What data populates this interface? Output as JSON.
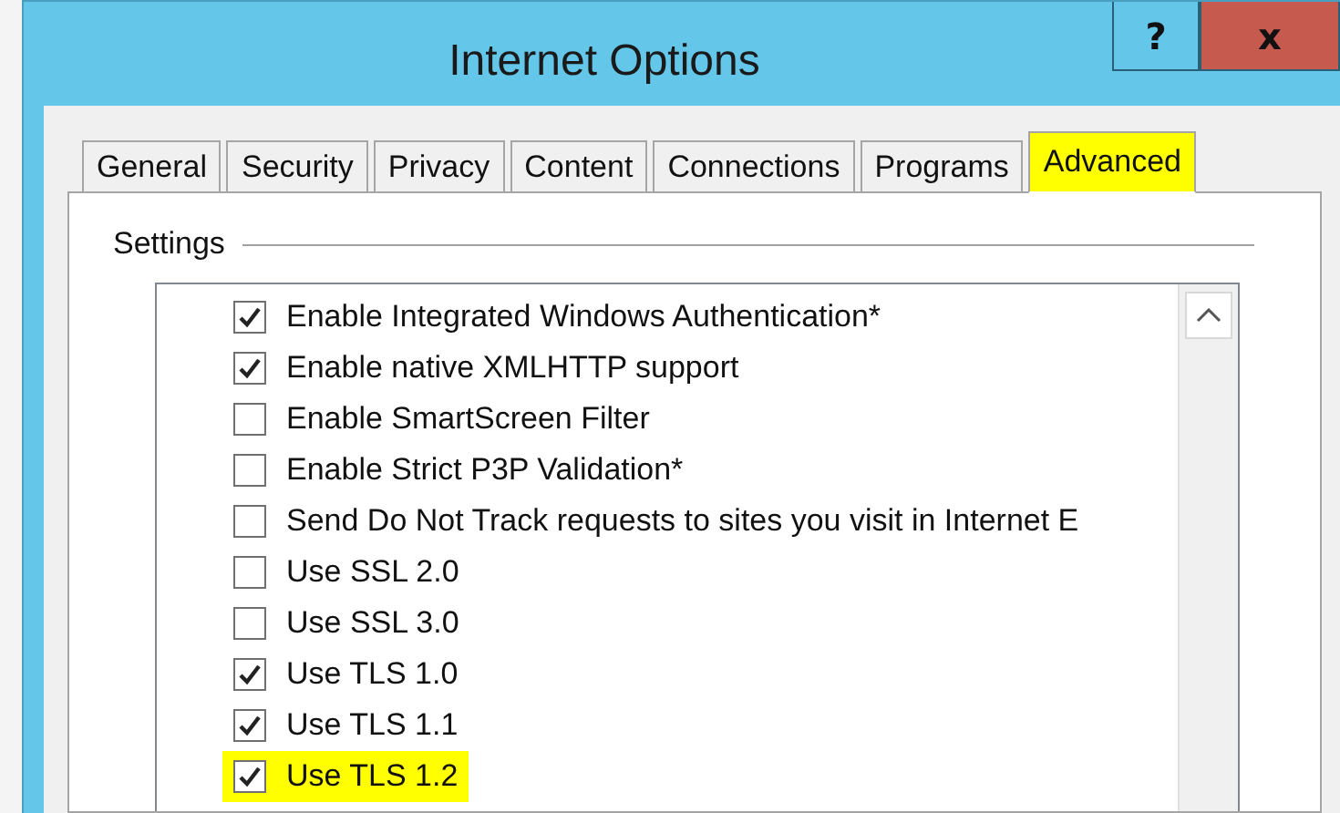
{
  "window": {
    "title": "Internet Options",
    "help_button": "?",
    "close_button": "x"
  },
  "tabs": [
    {
      "label": "General",
      "selected": false,
      "highlighted": false
    },
    {
      "label": "Security",
      "selected": false,
      "highlighted": false
    },
    {
      "label": "Privacy",
      "selected": false,
      "highlighted": false
    },
    {
      "label": "Content",
      "selected": false,
      "highlighted": false
    },
    {
      "label": "Connections",
      "selected": false,
      "highlighted": false
    },
    {
      "label": "Programs",
      "selected": false,
      "highlighted": false
    },
    {
      "label": "Advanced",
      "selected": true,
      "highlighted": true
    }
  ],
  "settings": {
    "title": "Settings",
    "items": [
      {
        "label": "Enable Integrated Windows Authentication*",
        "checked": true,
        "highlighted": false
      },
      {
        "label": "Enable native XMLHTTP support",
        "checked": true,
        "highlighted": false
      },
      {
        "label": "Enable SmartScreen Filter",
        "checked": false,
        "highlighted": false
      },
      {
        "label": "Enable Strict P3P Validation*",
        "checked": false,
        "highlighted": false
      },
      {
        "label": "Send Do Not Track requests to sites you visit in Internet E",
        "checked": false,
        "highlighted": false
      },
      {
        "label": "Use SSL 2.0",
        "checked": false,
        "highlighted": false
      },
      {
        "label": "Use SSL 3.0",
        "checked": false,
        "highlighted": false
      },
      {
        "label": "Use TLS 1.0",
        "checked": true,
        "highlighted": false
      },
      {
        "label": "Use TLS 1.1",
        "checked": true,
        "highlighted": false
      },
      {
        "label": "Use TLS 1.2",
        "checked": true,
        "highlighted": true
      }
    ]
  }
}
